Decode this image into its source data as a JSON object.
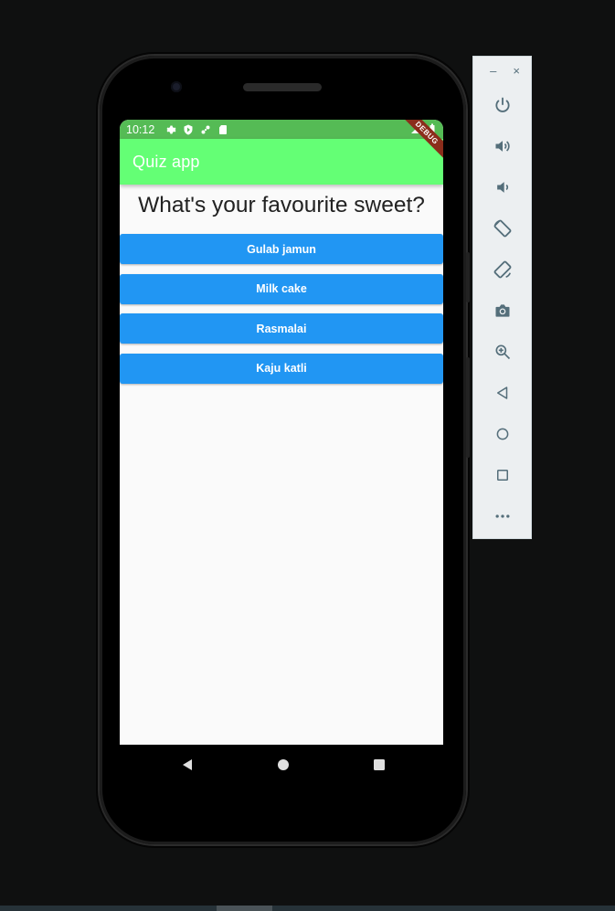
{
  "statusbar": {
    "time": "10:12"
  },
  "appbar": {
    "title": "Quiz app",
    "debug_label": "DEBUG"
  },
  "quiz": {
    "question": "What's your favourite sweet?",
    "answers": [
      "Gulab jamun",
      "Milk cake",
      "Rasmalai",
      "Kaju katli"
    ]
  },
  "colors": {
    "statusbar": "#55bb55",
    "appbar": "#64ff75",
    "answer_button": "#2196f3",
    "screen_bg": "#fafafa",
    "panel_bg": "#eceff1",
    "panel_icon": "#546e7a"
  },
  "emulator_panel": {
    "window_controls": [
      "–",
      "×"
    ],
    "buttons": [
      "power-icon",
      "volume-up-icon",
      "volume-down-icon",
      "rotate-left-icon",
      "rotate-right-icon",
      "camera-icon",
      "zoom-icon",
      "back-icon",
      "home-icon",
      "overview-icon",
      "more-icon"
    ]
  }
}
